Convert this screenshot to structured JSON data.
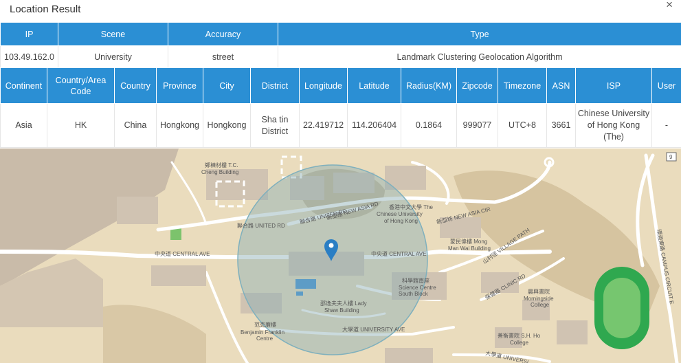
{
  "window": {
    "title": "Location Result",
    "close_icon": "×"
  },
  "summary": {
    "headers": [
      "IP",
      "Scene",
      "Accuracy",
      "Type"
    ],
    "row": [
      "103.49.162.0",
      "University",
      "street",
      "Landmark Clustering Geolocation Algorithm"
    ]
  },
  "details": {
    "headers": [
      "Continent",
      "Country/Area Code",
      "Country",
      "Province",
      "City",
      "District",
      "Longitude",
      "Latitude",
      "Radius(KM)",
      "Zipcode",
      "Timezone",
      "ASN",
      "ISP",
      "User"
    ],
    "row": [
      "Asia",
      "HK",
      "China",
      "Hongkong",
      "Hongkong",
      "Sha tin District",
      "22.419712",
      "114.206404",
      "0.1864",
      "999077",
      "UTC+8",
      "3661",
      "Chinese University of Hong Kong (The)",
      "-"
    ]
  },
  "map": {
    "marker_icon": "map-pin-icon",
    "labels": {
      "tc_cheng": "鄭棟材樓 T.C.",
      "tc_cheng2": "Cheng Building",
      "united_rd_1": "聯合路 UNITED RD",
      "united_rd_2": "聯合路 UNITED RD",
      "new_asia_rd": "新亞路 NEW ASIA RD",
      "cuhk_1": "香港中文大學 The",
      "cuhk_2": "Chinese University",
      "cuhk_3": "of Hong Kong",
      "new_asia_cir": "新亞坊 NEW ASIA CIR",
      "central_ave_1": "中央道 CENTRAL AVE",
      "central_ave_2": "中央道 CENTRAL AVE",
      "mong_1": "蒙民偉樓 Mong",
      "mong_2": "Man Wai Building",
      "village_path": "山村徑 VILLAGE PATH",
      "clinic_rd": "保健路 CLINIC RD",
      "science_1": "科學館南座",
      "science_2": "Science Centre",
      "science_3": "South Block",
      "morningside_1": "晨興書院",
      "morningside_2": "Morningside",
      "morningside_3": "College",
      "lady_shaw_1": "邵逸夫夫人樓 Lady",
      "lady_shaw_2": "Shaw Building",
      "university_ave": "大學道 UNIVERSITY AVE",
      "franklin_1": "范克廉樓",
      "franklin_2": "Benjamin Franklin",
      "franklin_3": "Centre",
      "sh_ho_1": "善衡書院 S.H. Ho",
      "sh_ho_2": "College",
      "university_ave_2": "大學道 UNIVERSI",
      "campus_circuit": "環迴東路 CAMPUS CIRCUIT E",
      "route_9": "9"
    }
  }
}
